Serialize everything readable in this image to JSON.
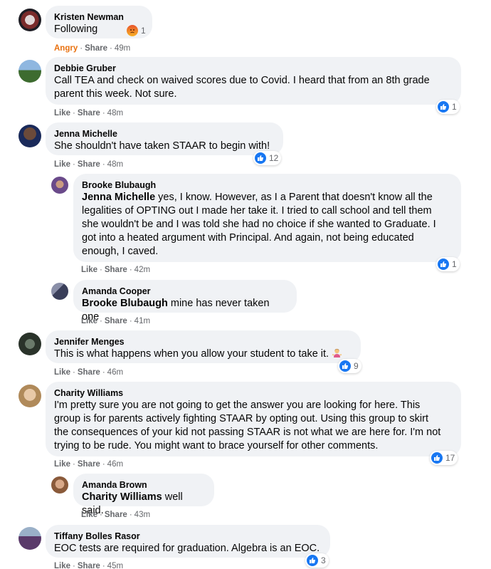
{
  "comments": [
    {
      "author": "Kristen Newman",
      "text": "Following",
      "reaction_count": "1",
      "actions": {
        "reacted": "Angry",
        "share": "Share",
        "time": "49m"
      }
    },
    {
      "author": "Debbie Gruber",
      "lines": [
        "Call TEA and check on waived scores due to Covid. I heard that from an 8th grade",
        "parent this week. Not sure."
      ],
      "reaction_count": "1",
      "actions": {
        "like": "Like",
        "share": "Share",
        "time": "48m"
      }
    },
    {
      "author": "Jenna Michelle",
      "text": "She shouldn't have taken STAAR to begin with!",
      "reaction_count": "12",
      "actions": {
        "like": "Like",
        "share": "Share",
        "time": "48m"
      }
    },
    {
      "author": "Brooke Blubaugh",
      "mention": "Jenna Michelle",
      "first_line": " yes, I know. However, as I a Parent that doesn't know all the",
      "lines": [
        "legalities of OPTING out I made her take it. I tried to call school and tell them",
        "she wouldn't be and I was told she had no choice if she wanted to Graduate. I",
        "got into a heated argument with Principal. And again, not being educated",
        "enough, I caved."
      ],
      "reaction_count": "1",
      "actions": {
        "like": "Like",
        "share": "Share",
        "time": "42m"
      }
    },
    {
      "author": "Amanda Cooper",
      "mention": "Brooke Blubaugh",
      "text": " mine has never taken one",
      "actions": {
        "like": "Like",
        "share": "Share",
        "time": "41m"
      }
    },
    {
      "author": "Jennifer Menges",
      "text": "This is what happens when you allow your student to take it.",
      "reaction_count": "9",
      "actions": {
        "like": "Like",
        "share": "Share",
        "time": "46m"
      }
    },
    {
      "author": "Charity Williams",
      "lines": [
        "I'm pretty sure you are not going to get the answer you are looking for here. This",
        "group is for parents actively fighting STAAR by opting out. Using this group to skirt",
        "the consequences of your kid not passing STAAR is not what we are here for. I'm not",
        "trying to be rude. You might want to brace yourself for other comments."
      ],
      "reaction_count": "17",
      "actions": {
        "like": "Like",
        "share": "Share",
        "time": "46m"
      }
    },
    {
      "author": "Amanda Brown",
      "mention": "Charity Williams",
      "text": " well said.",
      "actions": {
        "like": "Like",
        "share": "Share",
        "time": "43m"
      }
    },
    {
      "author": "Tiffany Bolles Rasor",
      "text": "EOC tests are required for graduation. Algebra is an EOC.",
      "reaction_count": "3",
      "actions": {
        "like": "Like",
        "share": "Share",
        "time": "45m"
      }
    }
  ],
  "colors": {
    "bubble": "#f0f2f5",
    "meta": "#65676b",
    "like_blue": "#1877f2",
    "angry": "#e9710f"
  },
  "icons": {
    "like": "thumbs-up-icon",
    "angry": "angry-face-icon",
    "emoji": "woman-shrugging-emoji-icon"
  }
}
